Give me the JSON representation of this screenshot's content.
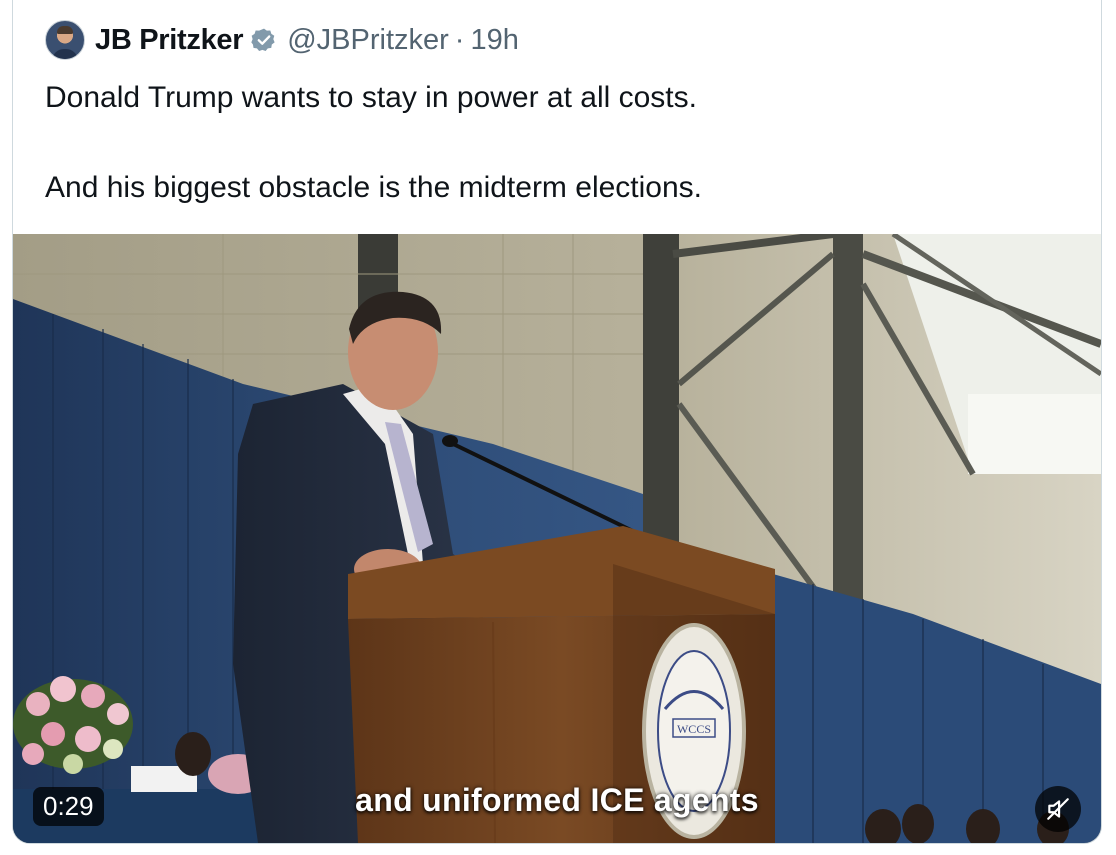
{
  "tweet": {
    "author": {
      "display_name": "JB Pritzker",
      "handle": "@JBPritzker",
      "separator": "·",
      "time": "19h",
      "avatar_icon": "profile-avatar",
      "verified_icon": "verified-badge-icon"
    },
    "text": {
      "line1": "Donald Trump wants to stay in power at all costs.",
      "line2": "And his biggest obstacle is the midterm elections."
    },
    "media": {
      "type": "video",
      "caption": "and uniformed ICE agents",
      "duration": "0:29",
      "podium_seal_text": "WCCS",
      "mute_icon": "speaker-muted-icon"
    }
  },
  "colors": {
    "text_primary": "#0f1419",
    "text_secondary": "#536471",
    "verified_badge": "#829aab",
    "border": "#cfd9de"
  }
}
